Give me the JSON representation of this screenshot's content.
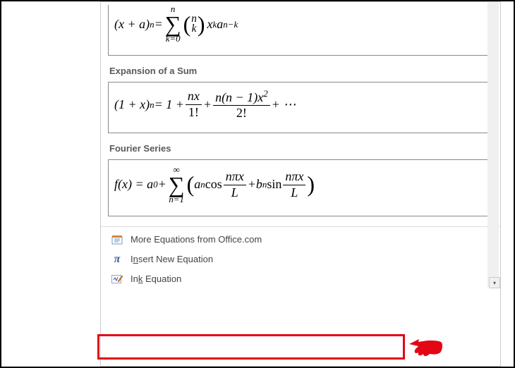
{
  "sections": {
    "expansion": {
      "title": "Expansion of a Sum"
    },
    "fourier": {
      "title": "Fourier Series"
    }
  },
  "equations": {
    "binomial": {
      "lhs_base1": "(x + a)",
      "lhs_exp": "n",
      "eq": " = ",
      "sigma_top": "n",
      "sigma_bottom": "k=0",
      "binom_top": "n",
      "binom_bottom": "k",
      "term_tail": "x",
      "term_tail_exp": "k",
      "term_tail2": "a",
      "term_tail2_exp": "n−k"
    },
    "expansion": {
      "lhs": "(1 + x)",
      "lhs_exp": "n",
      "eq": " = 1 + ",
      "t1_num": "nx",
      "t1_den": "1!",
      "plus": " + ",
      "t2_num": "n(n − 1)x",
      "t2_num_exp": "2",
      "t2_den": "2!",
      "tail": " + ⋯"
    },
    "fourier": {
      "lhs": "f(x) = a",
      "a0_sub": "0",
      "plus1": " + ",
      "sigma_top": "∞",
      "sigma_bottom": "n=1",
      "open": " ",
      "an": "a",
      "an_sub": "n",
      "cos": " cos",
      "f_num": "nπx",
      "f_den": "L",
      "plus2": " + ",
      "bn": "b",
      "bn_sub": "n",
      "sin": " sin"
    }
  },
  "menu": {
    "more": "More Equations from Office.com",
    "insert_pre": "I",
    "insert_u": "n",
    "insert_post": "sert New Equation",
    "ink_pre": "In",
    "ink_u": "k",
    "ink_post": " Equation"
  },
  "icons": {
    "more": "📇",
    "pi": "π",
    "ink": "✎"
  }
}
